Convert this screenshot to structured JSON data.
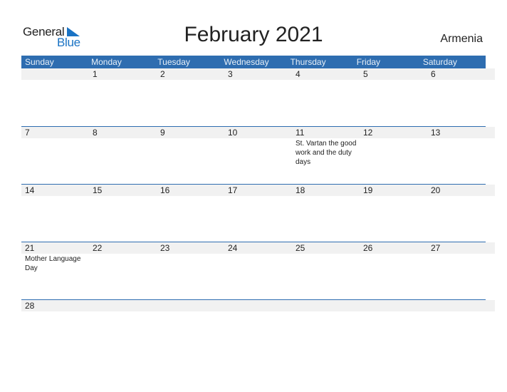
{
  "logo": {
    "word1": "General",
    "word2": "Blue",
    "accent": "#1a73c4"
  },
  "title": "February 2021",
  "country": "Armenia",
  "colors": {
    "header_bg": "#2e6db0",
    "day_bar": "#f1f1f1"
  },
  "weekdays": [
    "Sunday",
    "Monday",
    "Tuesday",
    "Wednesday",
    "Thursday",
    "Friday",
    "Saturday"
  ],
  "weeks": [
    {
      "days": [
        {
          "d": "",
          "ev": ""
        },
        {
          "d": "1",
          "ev": ""
        },
        {
          "d": "2",
          "ev": ""
        },
        {
          "d": "3",
          "ev": ""
        },
        {
          "d": "4",
          "ev": ""
        },
        {
          "d": "5",
          "ev": ""
        },
        {
          "d": "6",
          "ev": ""
        }
      ]
    },
    {
      "days": [
        {
          "d": "7",
          "ev": ""
        },
        {
          "d": "8",
          "ev": ""
        },
        {
          "d": "9",
          "ev": ""
        },
        {
          "d": "10",
          "ev": ""
        },
        {
          "d": "11",
          "ev": "St. Vartan the good work and the duty days"
        },
        {
          "d": "12",
          "ev": ""
        },
        {
          "d": "13",
          "ev": ""
        }
      ]
    },
    {
      "days": [
        {
          "d": "14",
          "ev": ""
        },
        {
          "d": "15",
          "ev": ""
        },
        {
          "d": "16",
          "ev": ""
        },
        {
          "d": "17",
          "ev": ""
        },
        {
          "d": "18",
          "ev": ""
        },
        {
          "d": "19",
          "ev": ""
        },
        {
          "d": "20",
          "ev": ""
        }
      ]
    },
    {
      "days": [
        {
          "d": "21",
          "ev": "Mother Language Day"
        },
        {
          "d": "22",
          "ev": ""
        },
        {
          "d": "23",
          "ev": ""
        },
        {
          "d": "24",
          "ev": ""
        },
        {
          "d": "25",
          "ev": ""
        },
        {
          "d": "26",
          "ev": ""
        },
        {
          "d": "27",
          "ev": ""
        }
      ]
    },
    {
      "days": [
        {
          "d": "28",
          "ev": ""
        },
        {
          "d": "",
          "ev": ""
        },
        {
          "d": "",
          "ev": ""
        },
        {
          "d": "",
          "ev": ""
        },
        {
          "d": "",
          "ev": ""
        },
        {
          "d": "",
          "ev": ""
        },
        {
          "d": "",
          "ev": ""
        }
      ]
    }
  ]
}
